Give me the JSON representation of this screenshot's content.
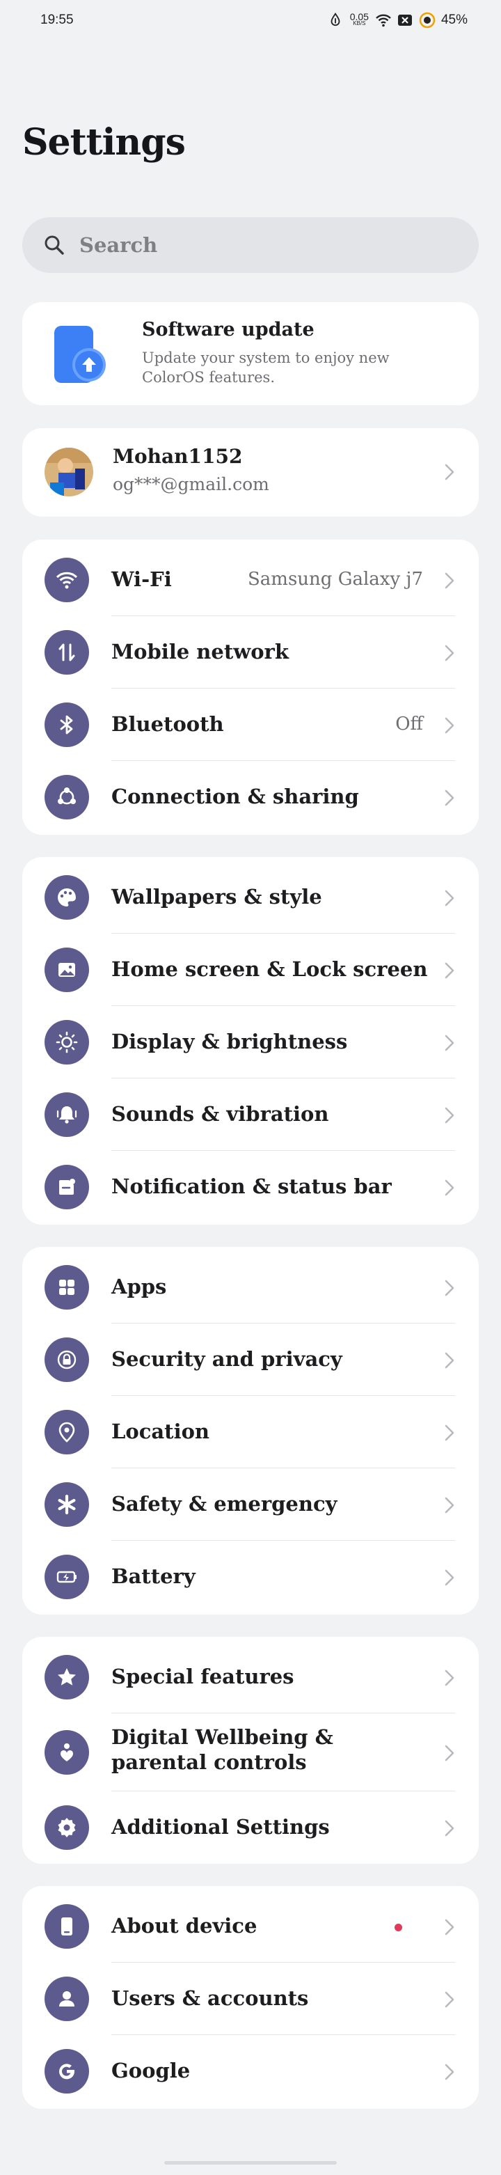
{
  "status_bar": {
    "time": "19:55",
    "net_speed_value": "0.05",
    "net_speed_unit": "KB/S",
    "battery_percent": "45%"
  },
  "page": {
    "title": "Settings"
  },
  "search": {
    "placeholder": "Search"
  },
  "software_update": {
    "title": "Software update",
    "description": "Update your system to enjoy new ColorOS features."
  },
  "account": {
    "name": "Mohan1152",
    "email": "og***@gmail.com"
  },
  "groups": [
    {
      "items": [
        {
          "label": "Wi-Fi",
          "value": "Samsung Galaxy j7",
          "icon": "wifi-icon"
        },
        {
          "label": "Mobile network",
          "value": "",
          "icon": "mobile-network-icon"
        },
        {
          "label": "Bluetooth",
          "value": "Off",
          "icon": "bluetooth-icon"
        },
        {
          "label": "Connection & sharing",
          "value": "",
          "icon": "share-icon"
        }
      ]
    },
    {
      "items": [
        {
          "label": "Wallpapers & style",
          "icon": "palette-icon"
        },
        {
          "label": "Home screen & Lock screen",
          "icon": "image-icon"
        },
        {
          "label": "Display & brightness",
          "icon": "brightness-icon"
        },
        {
          "label": "Sounds & vibration",
          "icon": "bell-icon"
        },
        {
          "label": "Notification & status bar",
          "icon": "notification-icon"
        }
      ]
    },
    {
      "items": [
        {
          "label": "Apps",
          "icon": "apps-grid-icon"
        },
        {
          "label": "Security and privacy",
          "icon": "lock-icon"
        },
        {
          "label": "Location",
          "icon": "location-pin-icon"
        },
        {
          "label": "Safety & emergency",
          "icon": "asterisk-icon"
        },
        {
          "label": "Battery",
          "icon": "battery-icon"
        }
      ]
    },
    {
      "items": [
        {
          "label": "Special features",
          "icon": "star-icon"
        },
        {
          "label": "Digital Wellbeing & parental controls",
          "icon": "wellbeing-icon"
        },
        {
          "label": "Additional Settings",
          "icon": "gear-icon"
        }
      ]
    },
    {
      "items": [
        {
          "label": "About device",
          "icon": "phone-icon",
          "badge": "red-dot"
        },
        {
          "label": "Users & accounts",
          "icon": "user-icon"
        },
        {
          "label": "Google",
          "icon": "google-icon"
        }
      ]
    }
  ],
  "colors": {
    "background": "#f1f2f4",
    "card": "#ffffff",
    "icon_circle": "#5d5a8e",
    "update_blue": "#3d7ff5",
    "badge_red": "#e3385a"
  }
}
